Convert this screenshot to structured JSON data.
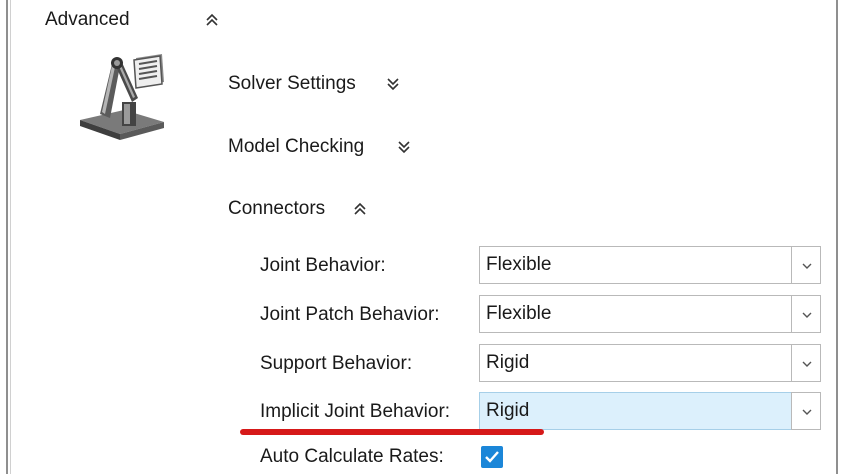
{
  "advanced": {
    "title": "Advanced",
    "expanded": true,
    "icon": "robot-arm-icon"
  },
  "sections": [
    {
      "label": "Solver Settings",
      "expanded": false
    },
    {
      "label": "Model Checking",
      "expanded": false
    },
    {
      "label": "Connectors",
      "expanded": true
    }
  ],
  "connectors": {
    "rows": [
      {
        "label": "Joint Behavior:",
        "value": "Flexible"
      },
      {
        "label": "Joint Patch Behavior:",
        "value": "Flexible"
      },
      {
        "label": "Support Behavior:",
        "value": "Rigid"
      },
      {
        "label": "Implicit Joint Behavior:",
        "value": "Rigid",
        "selected": true
      }
    ],
    "auto_calc": {
      "label": "Auto Calculate Rates:",
      "checked": true
    }
  },
  "colors": {
    "accent": "#1b86d8",
    "selected_bg": "#dcf0fc",
    "annotation_red": "#d61919"
  }
}
